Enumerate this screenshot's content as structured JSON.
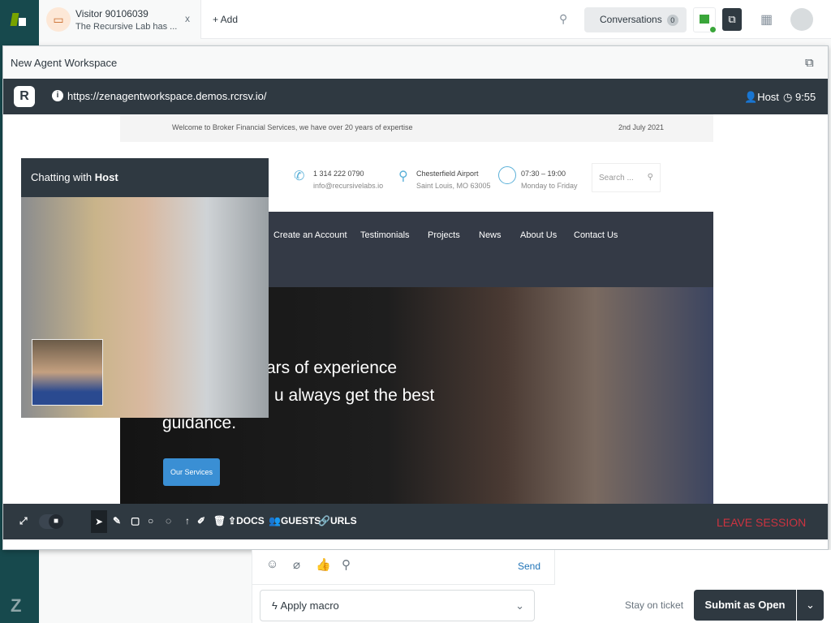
{
  "topbar": {
    "tab": {
      "title": "Visitor 90106039",
      "subtitle": "The Recursive Lab has ...",
      "close": "x"
    },
    "add": "+ Add",
    "conversations": "Conversations",
    "conversations_count": "0"
  },
  "workspace": {
    "title": "New Agent Workspace",
    "url": "https://zenagentworkspace.demos.rcrsv.io/",
    "role": "Host",
    "timer": "9:55"
  },
  "site": {
    "welcome": "Welcome to Broker Financial Services, we have over 20 years of expertise",
    "date": "2nd July 2021",
    "phone": "1 314 222 0790",
    "email": "info@recursivelabs.io",
    "location": "Chesterfield Airport",
    "address": "Saint Louis, MO 63005",
    "hours": "07:30 – 19:00",
    "days": "Monday to Friday",
    "search_placeholder": "Search ...",
    "nav": [
      "Create an Account",
      "Testimonials",
      "Projects",
      "News",
      "About Us",
      "Contact Us"
    ],
    "hero": [
      "ars of experience",
      "u always get the best",
      "guidance."
    ],
    "cta": "Our Services"
  },
  "video": {
    "chat_prefix": "Chatting with ",
    "chat_name": "Host"
  },
  "toolbar": {
    "docs": "DOCS",
    "guests": "GUESTS",
    "urls": "URLS",
    "leave": "LEAVE SESSION"
  },
  "composer": {
    "send": "Send",
    "macro": "Apply macro",
    "stay": "Stay on ticket",
    "submit_prefix": "Submit as ",
    "submit_status": "Open"
  },
  "colors": {
    "nav": "#17494d",
    "dark": "#2f3941",
    "leave": "#cc3340",
    "cta": "#3a8fd4"
  }
}
